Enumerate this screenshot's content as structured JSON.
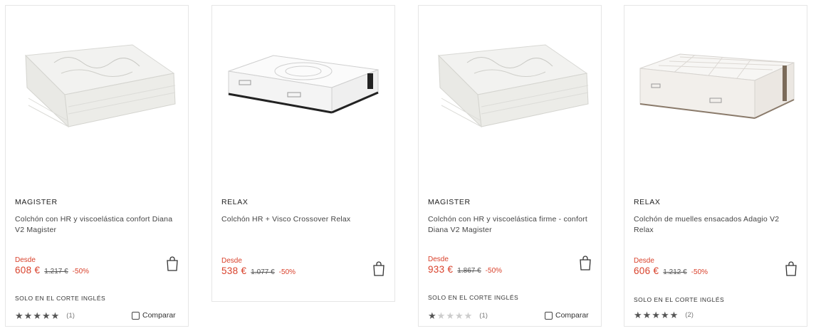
{
  "products": [
    {
      "brand": "MAGISTER",
      "title": "Colchón con HR y viscoelástica confort Diana V2 Magister",
      "desde": "Desde",
      "price": "608 €",
      "old_price": "1.217 €",
      "discount": "-50%",
      "exclusive": "SOLO EN EL CORTE INGLÉS",
      "rating": 5,
      "reviews": "(1)",
      "compare_label": "Comparar",
      "image": "mattress-quilted-pattern"
    },
    {
      "brand": "RELAX",
      "title": "Colchón HR + Visco Crossover Relax",
      "desde": "Desde",
      "price": "538 €",
      "old_price": "1.077 €",
      "discount": "-50%",
      "exclusive": "",
      "rating": null,
      "reviews": "",
      "compare_label": "",
      "image": "mattress-black-border"
    },
    {
      "brand": "MAGISTER",
      "title": "Colchón con HR y viscoelástica firme - confort Diana V2 Magister",
      "desde": "Desde",
      "price": "933 €",
      "old_price": "1.867 €",
      "discount": "-50%",
      "exclusive": "SOLO EN EL CORTE INGLÉS",
      "rating": 1,
      "reviews": "(1)",
      "compare_label": "Comparar",
      "image": "mattress-quilted-pattern"
    },
    {
      "brand": "RELAX",
      "title": "Colchón de muelles ensacados Adagio V2 Relax",
      "desde": "Desde",
      "price": "606 €",
      "old_price": "1.212 €",
      "discount": "-50%",
      "exclusive": "SOLO EN EL CORTE INGLÉS",
      "rating": 5,
      "reviews": "(2)",
      "compare_label": "",
      "image": "mattress-pillowtop"
    }
  ],
  "colors": {
    "price_red": "#d9412b",
    "border": "#e6e6e6",
    "star_on": "#555555",
    "star_off": "#cccccc"
  },
  "icons": {
    "bag": "shopping-bag-icon",
    "star": "star-icon",
    "checkbox": "checkbox-icon"
  }
}
